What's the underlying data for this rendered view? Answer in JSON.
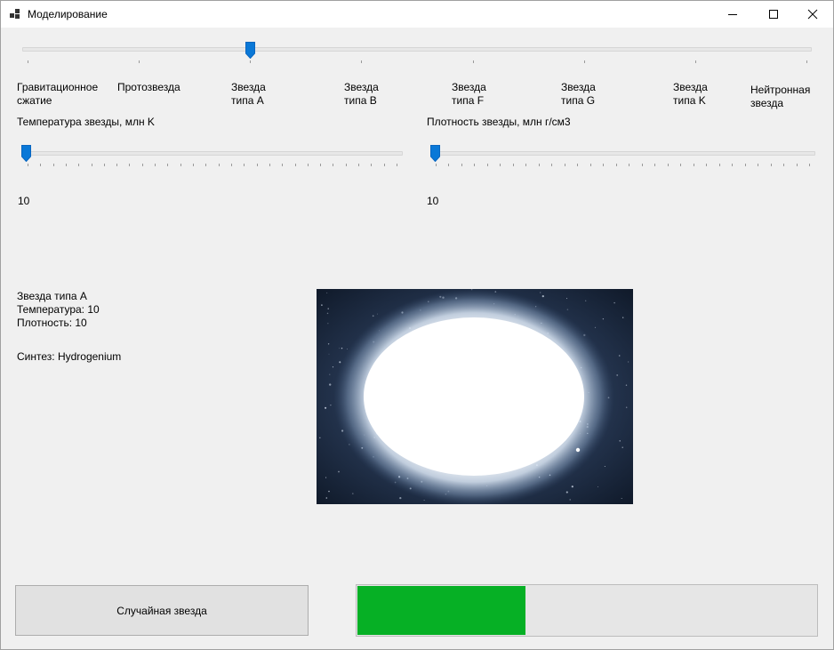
{
  "window": {
    "title": "Моделирование"
  },
  "stage_slider": {
    "value": 2,
    "max": 7,
    "labels": [
      [
        "Гравитационное",
        "сжатие"
      ],
      [
        "Протозвезда",
        ""
      ],
      [
        "Звезда",
        "типа A"
      ],
      [
        "Звезда",
        "типа B"
      ],
      [
        "Звезда",
        "типа F"
      ],
      [
        "Звезда",
        "типа G"
      ],
      [
        "Звезда",
        "типа K"
      ],
      [
        "Нейтронная",
        "звезда"
      ]
    ]
  },
  "temperature": {
    "label": "Температура звезды, млн K",
    "value": "10"
  },
  "density": {
    "label": "Плотность звезды, млн г/см3",
    "value": "10"
  },
  "info": {
    "type_line": "Звезда типа A",
    "temperature_line": "Температура: 10",
    "density_line": "Плотность: 10",
    "synthesis_line": "Синтез: Hydrogenium"
  },
  "random_button": {
    "label": "Случайная звезда"
  },
  "progress": {
    "fraction": 0.365,
    "color": "#06b025"
  },
  "icons": {
    "app": "app-icon",
    "minimize": "minimize-icon",
    "maximize": "maximize-icon",
    "close": "close-icon"
  },
  "colors": {
    "slider_thumb": "#0a78d7",
    "progress_fill": "#06b025"
  }
}
